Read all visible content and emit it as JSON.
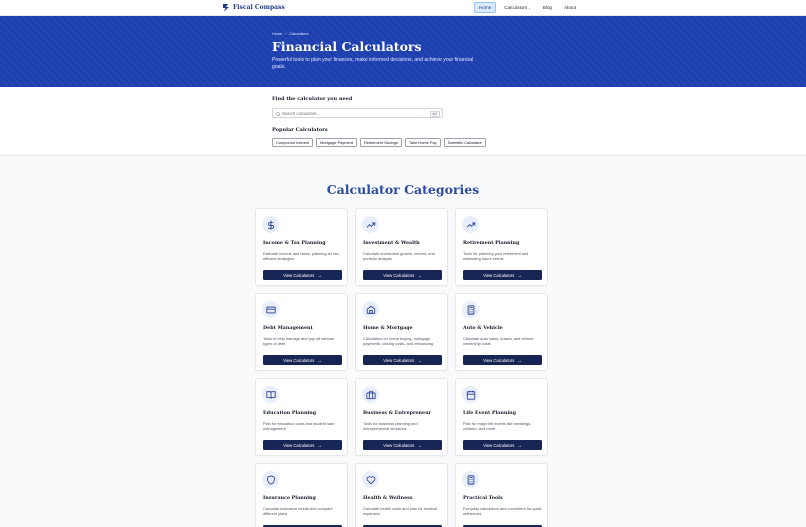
{
  "nav": {
    "brand": "Fiscal Compass",
    "links": [
      "Home",
      "Calculators",
      "Blog",
      "About"
    ]
  },
  "hero": {
    "breadcrumb": [
      "Home",
      "›",
      "Calculators"
    ],
    "title": "Financial Calculators",
    "subtitle": "Powerful tools to plan your finances, make informed decisions, and achieve your financial goals."
  },
  "search": {
    "label": "Find the calculator you need",
    "placeholder": "Search calculators...",
    "shortcut": "⌘K",
    "popular_label": "Popular Calculators",
    "popular": [
      "Compound Interest",
      "Mortgage Payment",
      "Retirement Savings",
      "Take-Home Pay",
      "Scientific Calculator"
    ]
  },
  "categories": {
    "title": "Calculator Categories",
    "button_label": "View Calculators",
    "button_arrow": "→",
    "items": [
      {
        "icon": "dollar-icon",
        "title": "Income & Tax Planning",
        "desc": "Estimate income and taxes, planning for tax-efficient strategies"
      },
      {
        "icon": "trend-up-icon",
        "title": "Investment & Wealth",
        "desc": "Calculate investment growth, returns, and portfolio analysis"
      },
      {
        "icon": "trend-up-icon",
        "title": "Retirement Planning",
        "desc": "Tools for planning your retirement and estimating future needs"
      },
      {
        "icon": "credit-card-icon",
        "title": "Debt Management",
        "desc": "Tools to help manage and pay off various types of debt"
      },
      {
        "icon": "home-icon",
        "title": "Home & Mortgage",
        "desc": "Calculators for home buying, mortgage payments, closing costs, and refinancing"
      },
      {
        "icon": "calculator-icon",
        "title": "Auto & Vehicle",
        "desc": "Calculate auto loans, leases, and vehicle ownership costs"
      },
      {
        "icon": "book-icon",
        "title": "Education Planning",
        "desc": "Plan for education costs and student loan management"
      },
      {
        "icon": "briefcase-icon",
        "title": "Business & Entrepreneur",
        "desc": "Tools for business planning and entrepreneurial decisions"
      },
      {
        "icon": "calendar-icon",
        "title": "Life Event Planning",
        "desc": "Plan for major life events like weddings, children, and more"
      },
      {
        "icon": "shield-icon",
        "title": "Insurance Planning",
        "desc": "Calculate insurance needs and compare different plans"
      },
      {
        "icon": "heart-icon",
        "title": "Health & Wellness",
        "desc": "Calculate health costs and plan for medical expenses"
      },
      {
        "icon": "calculator-icon",
        "title": "Practical Tools",
        "desc": "Everyday calculators and converters for quick references"
      }
    ]
  },
  "colors": {
    "hero_bg": "#1e40af",
    "button_bg": "#172554",
    "heading_blue": "#2b4aa3",
    "icon_bg": "#e8eefc"
  }
}
